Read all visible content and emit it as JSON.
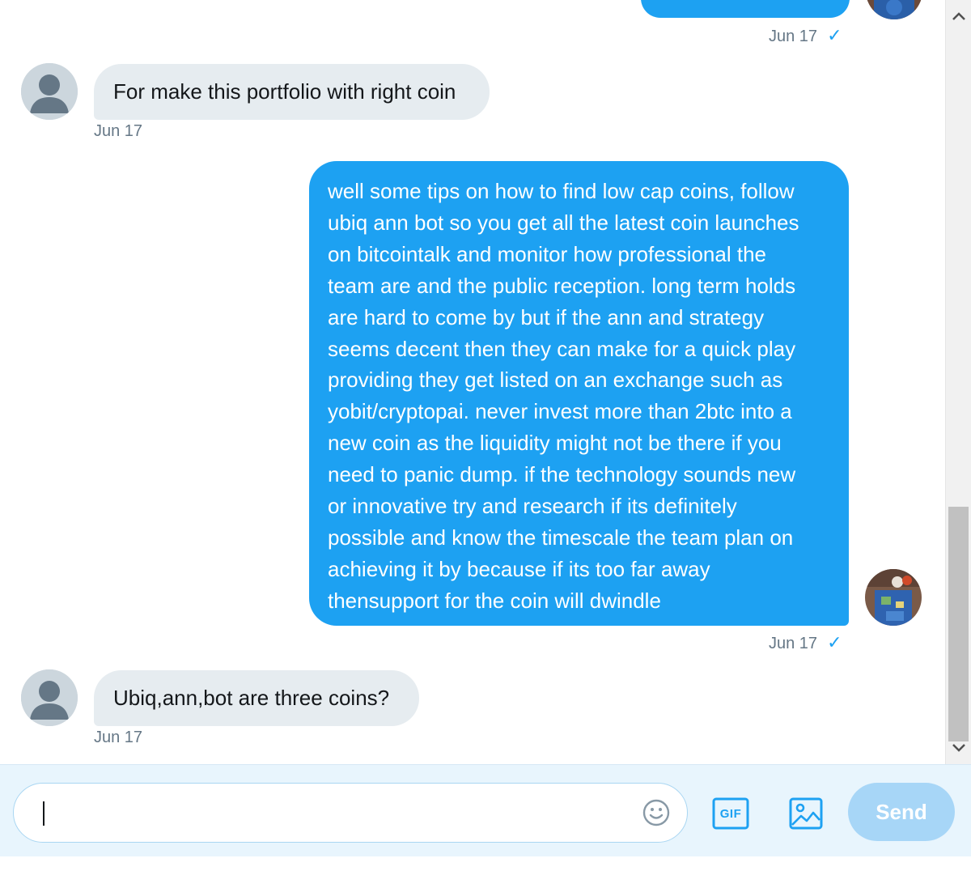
{
  "messages": [
    {
      "direction": "outgoing",
      "text": "",
      "timestamp": "Jun 17",
      "read_receipt": "✓"
    },
    {
      "direction": "incoming",
      "text": "For make this portfolio with right coin",
      "timestamp": "Jun 17"
    },
    {
      "direction": "outgoing",
      "lines": [
        "well some tips on how to find low cap coins, follow",
        "ubiq ann bot so you get all the latest coin launches",
        "on bitcointalk and monitor how professional the",
        "team are and the public reception. long term holds",
        "are hard to come by but if the ann and strategy",
        "seems decent then they can make for a quick play",
        "providing they get listed on an exchange such as",
        "yobit/cryptopai. never invest more than 2btc into a",
        "new coin as the liquidity might not be there if you",
        "need to panic dump. if the technology sounds new",
        "or innovative try and research if its definitely",
        "possible and know the timescale the team plan on",
        "achieving it by because if its too far away",
        "thensupport for the coin will dwindle"
      ],
      "timestamp": "Jun 17",
      "read_receipt": "✓"
    },
    {
      "direction": "incoming",
      "text": "Ubiq,ann,bot are three coins?",
      "timestamp": "Jun 17"
    }
  ],
  "composer": {
    "placeholder": "",
    "emoji_icon": "smiley-icon",
    "gif_label": "GIF",
    "image_icon": "image-icon",
    "send_label": "Send"
  },
  "colors": {
    "outgoing_bubble": "#1da1f2",
    "incoming_bubble": "#e6ecf0",
    "send_disabled": "#a7d6f7",
    "composer_bg": "#e8f5fd"
  }
}
